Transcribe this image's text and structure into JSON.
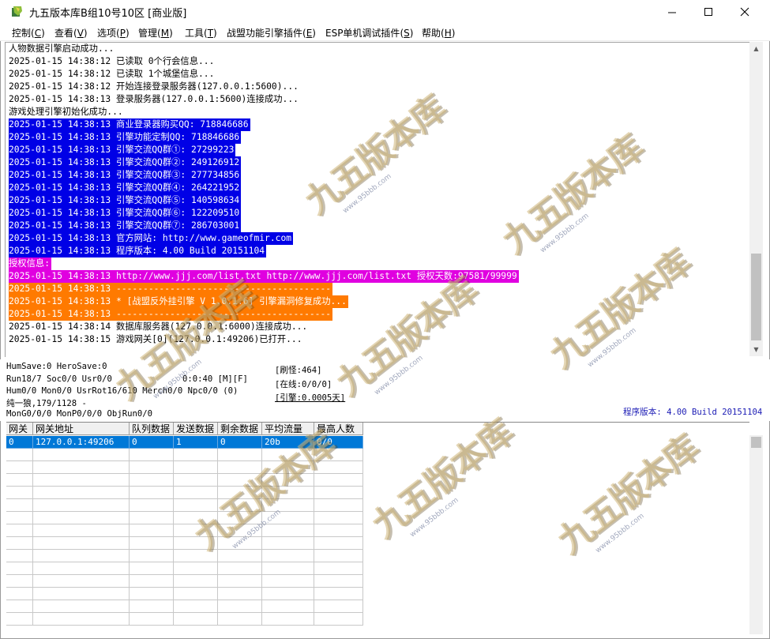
{
  "window": {
    "title": "九五版本库B组10号10区 [商业版]"
  },
  "menu": [
    {
      "label": "控制",
      "key": "C"
    },
    {
      "label": "查看",
      "key": "V"
    },
    {
      "label": "选项",
      "key": "P"
    },
    {
      "label": "管理",
      "key": "M"
    },
    {
      "label": "工具",
      "key": "T"
    },
    {
      "label": "战盟功能引擎插件",
      "key": "E"
    },
    {
      "label": "ESP单机调试插件",
      "key": "S"
    },
    {
      "label": "帮助",
      "key": "H"
    }
  ],
  "colors": {
    "blue_hl": "#0000e6",
    "magenta_hl": "#e000e0",
    "orange_hl": "#ff7a00",
    "grid_sel": "#0078d7",
    "version_text": "#1a1ab4"
  },
  "log": [
    {
      "text": "人物数据引擎启动成功...",
      "hl": ""
    },
    {
      "text": "2025-01-15 14:38:12 已读取 0个行会信息...",
      "hl": ""
    },
    {
      "text": "2025-01-15 14:38:12 已读取 1个城堡信息...",
      "hl": ""
    },
    {
      "text": "2025-01-15 14:38:12 开始连接登录服务器(127.0.0.1:5600)...",
      "hl": ""
    },
    {
      "text": "2025-01-15 14:38:13 登录服务器(127.0.0.1:5600)连接成功...",
      "hl": ""
    },
    {
      "text": "游戏处理引擎初始化成功...",
      "hl": ""
    },
    {
      "text": "2025-01-15 14:38:13 商业登录器购买QQ: 718846686",
      "hl": "blue"
    },
    {
      "text": "2025-01-15 14:38:13 引擎功能定制QQ: 718846686",
      "hl": "blue"
    },
    {
      "text": "2025-01-15 14:38:13 引擎交流QQ群①: 27299223",
      "hl": "blue"
    },
    {
      "text": "2025-01-15 14:38:13 引擎交流QQ群②: 249126912",
      "hl": "blue"
    },
    {
      "text": "2025-01-15 14:38:13 引擎交流QQ群③: 277734856",
      "hl": "blue"
    },
    {
      "text": "2025-01-15 14:38:13 引擎交流QQ群④: 264221952",
      "hl": "blue"
    },
    {
      "text": "2025-01-15 14:38:13 引擎交流QQ群⑤: 140598634",
      "hl": "blue"
    },
    {
      "text": "2025-01-15 14:38:13 引擎交流QQ群⑥: 122209510",
      "hl": "blue"
    },
    {
      "text": "2025-01-15 14:38:13 引擎交流QQ群⑦: 286703001",
      "hl": "blue"
    },
    {
      "text": "2025-01-15 14:38:13 官方网站: http://www.gameofmir.com",
      "hl": "blue"
    },
    {
      "text": "2025-01-15 14:38:13 程序版本: 4.00 Build 20151104",
      "hl": "blue"
    },
    {
      "text": "授权信息:",
      "hl": "magenta"
    },
    {
      "text": "2025-01-15 14:38:13 http://www.jjj.com/list.txt http://www.jjj.com/list.txt 授权天数:97581/99999",
      "hl": "magenta"
    },
    {
      "text": "2025-01-15 14:38:13 ----------------------------------------",
      "hl": "orange"
    },
    {
      "text": "2025-01-15 14:38:13 * [战盟反外挂引擎 V 1.0.1.6] 引擎漏洞修复成功...",
      "hl": "orange"
    },
    {
      "text": "2025-01-15 14:38:13 ----------------------------------------",
      "hl": "orange"
    },
    {
      "text": "2025-01-15 14:38:14 数据库服务器(127.0.0.1:6000)连接成功...",
      "hl": ""
    },
    {
      "text": "2025-01-15 14:38:15 游戏网关[0](127.0.0.1:49206)已打开...",
      "hl": ""
    }
  ],
  "status": {
    "line1": "HumSave:0 HeroSave:0",
    "line2": "Run18/7 Soc0/0 Usr0/0",
    "timer": "0:0:40 [M][F]",
    "line3": "Hum0/0 Mon0/0 UsrRot16/610 Merch0/0 Npc0/0 (0)",
    "line4": "纯一狼,179/1128 -",
    "line5": "MonG0/0/0 MonP0/0/0 ObjRun0/0",
    "refresh": "[刷怪:464]",
    "online": "[在线:0/0/0]",
    "engine": "[引擎:0.0005天]",
    "version": "程序版本: 4.00 Build 20151104"
  },
  "grid": {
    "columns": [
      "网关",
      "网关地址",
      "队列数据",
      "发送数据",
      "剩余数据",
      "平均流量",
      "最高人数"
    ],
    "rows": [
      [
        "0",
        "127.0.0.1:49206",
        "0",
        "1",
        "0",
        "20b",
        "0/0"
      ]
    ]
  },
  "watermark": {
    "text": "九五版本库",
    "sub": "www.95bbb.com"
  }
}
